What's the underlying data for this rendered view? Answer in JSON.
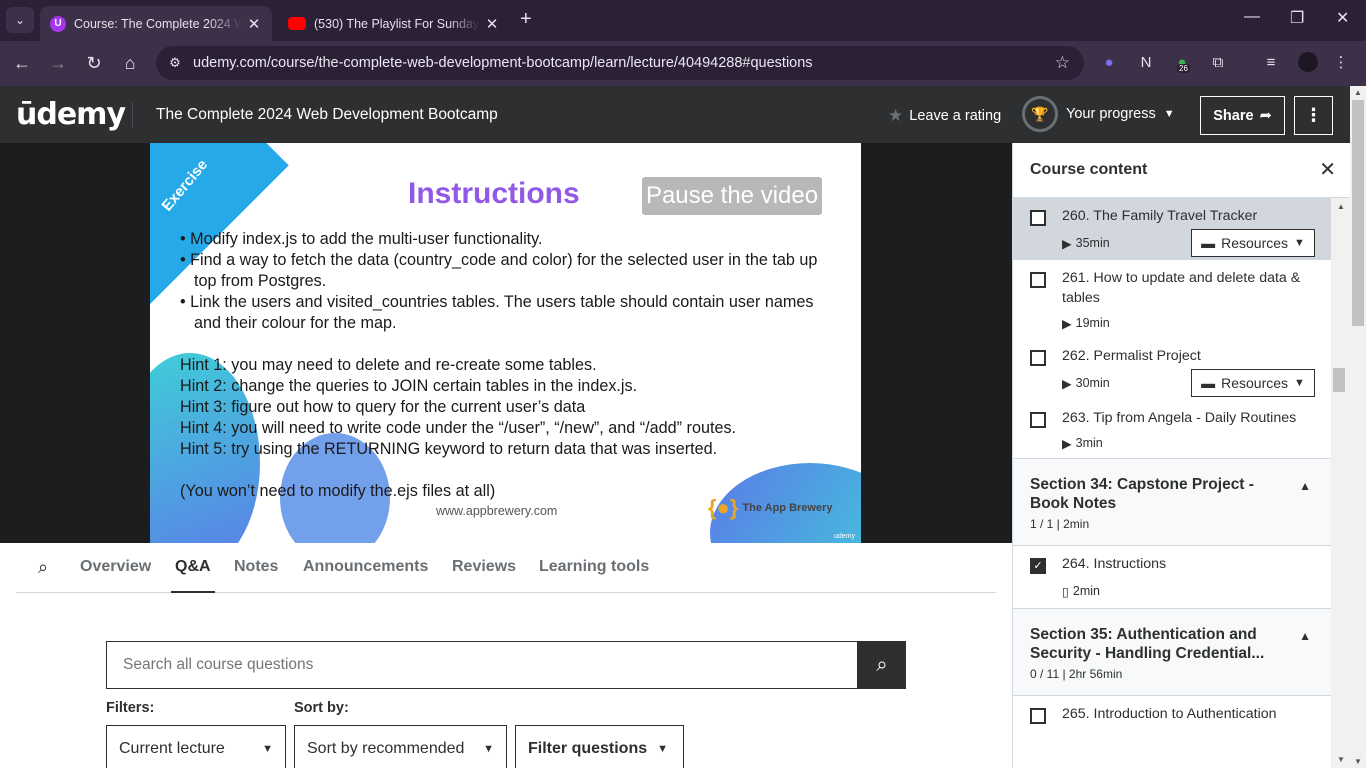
{
  "browser": {
    "tabs": [
      {
        "title": "Course: The Complete 2024 We",
        "icon": "udemy-favicon",
        "active": true
      },
      {
        "title": "(530) The Playlist For Sunday - \\",
        "icon": "youtube-favicon",
        "active": false
      }
    ],
    "url": "udemy.com/course/the-complete-web-development-bootcamp/learn/lecture/40494288#questions",
    "extension_badge": "26"
  },
  "header": {
    "logo": "ūdemy",
    "course_title": "The Complete 2024 Web Development Bootcamp",
    "rating_label": "Leave a rating",
    "progress_label": "Your progress",
    "share_label": "Share"
  },
  "slide": {
    "corner_label": "Exercise",
    "heading": "Instructions",
    "pause_label": "Pause the video",
    "bullets": [
      "• Modify index.js to add the multi-user functionality.",
      "• Find a way to fetch the data (country_code and color) for the selected user in the tab up top from Postgres.",
      "• Link the users and visited_countries tables. The users table should contain user names and their colour for the map."
    ],
    "hints": [
      "Hint 1: you may need to delete and re-create some tables.",
      "Hint 2: change the queries to JOIN certain tables in the index.js.",
      "Hint 3: figure out how to query for the current user’s data",
      "Hint 4: you will need to write code under  the “/user”, “/new”, and “/add” routes.",
      "Hint 5: try using the RETURNING keyword to return data that was inserted."
    ],
    "footer_note": "(You won’t need to modify the.ejs files at all)",
    "site": "www.appbrewery.com",
    "brand": "The App Brewery",
    "watermark": "udemy"
  },
  "lecture_tabs": [
    "Overview",
    "Q&A",
    "Notes",
    "Announcements",
    "Reviews",
    "Learning tools"
  ],
  "qa": {
    "search_placeholder": "Search all course questions",
    "filters_label": "Filters:",
    "sort_label": "Sort by:",
    "filter_value": "Current lecture",
    "sort_value": "Sort by recommended",
    "filter_questions_label": "Filter questions"
  },
  "sidebar": {
    "title": "Course content",
    "items_a": [
      {
        "name": "260. The Family Travel Tracker",
        "duration": "35min",
        "resources": "Resources",
        "current": true
      },
      {
        "name": "261. How to update and delete data & tables",
        "duration": "19min"
      },
      {
        "name": "262. Permalist Project",
        "duration": "30min",
        "resources": "Resources"
      },
      {
        "name": "263. Tip from Angela - Daily Routines",
        "duration": "3min"
      }
    ],
    "section34": {
      "title": "Section 34: Capstone Project - Book Notes",
      "stats": "1 / 1 | 2min"
    },
    "item264": {
      "name": "264. Instructions",
      "duration": "2min"
    },
    "section35": {
      "title": "Section 35: Authentication and Security - Handling Credential...",
      "stats": "0 / 11 | 2hr 56min"
    },
    "item265": {
      "name": "265. Introduction to Authentication"
    }
  }
}
